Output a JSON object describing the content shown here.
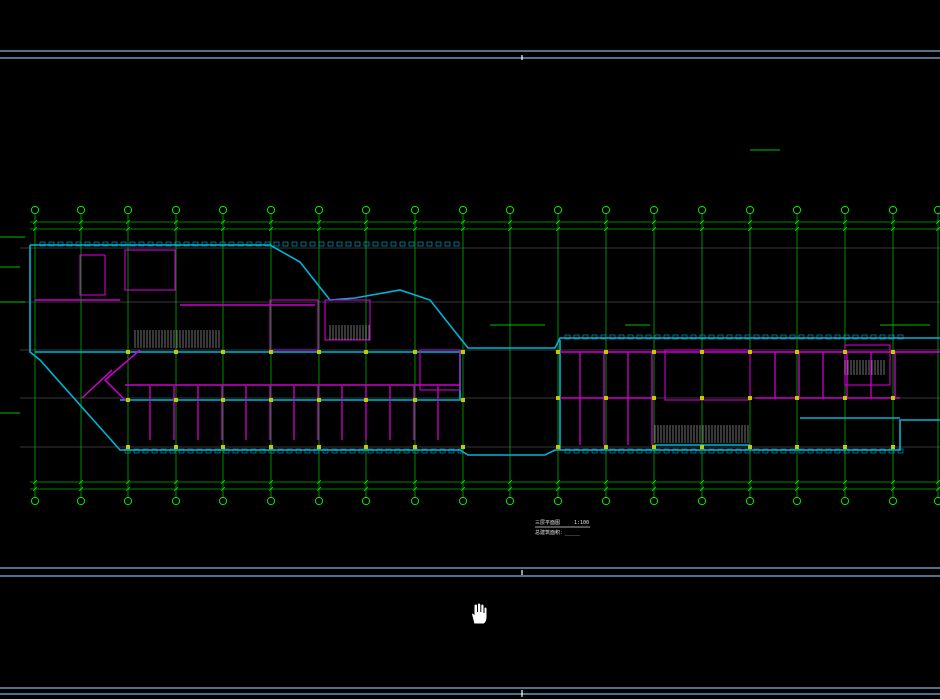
{
  "viewer": {
    "background": "#000000",
    "frame_color": "#7fb2e0",
    "cursor_icon": "hand-pan-icon"
  },
  "drawing": {
    "colors": {
      "axis": "#00c800",
      "wall": "#00b4d8",
      "partition": "#d000d0",
      "grid": "#707070",
      "column": "#c8c800",
      "annotation": "#00ff00",
      "text": "#e0e0e0"
    },
    "axis_count": 20,
    "title_block": [
      "三层平面图",
      "1:100",
      "总建筑面积：_____"
    ]
  }
}
